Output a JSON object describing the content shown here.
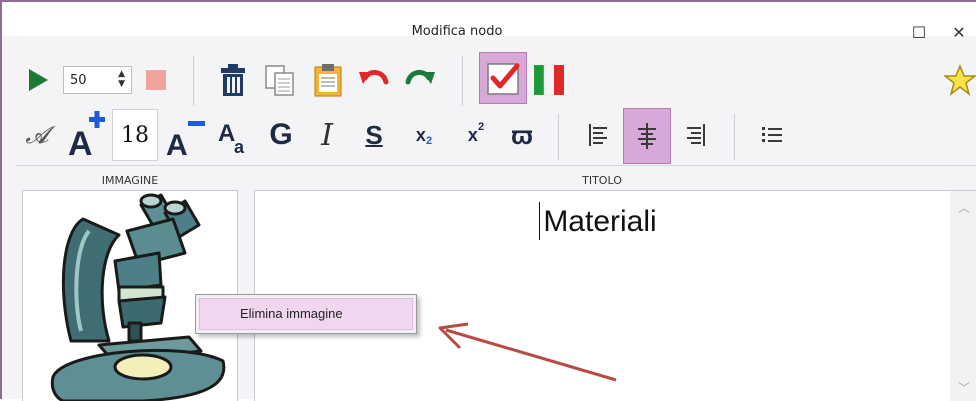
{
  "window": {
    "title": "Modifica nodo",
    "maximize_glyph": "☐",
    "close_glyph": "✕"
  },
  "toolbar1": {
    "play_icon": "play-icon",
    "speed_value": "50",
    "stop_icon": "stop-icon",
    "delete_icon": "trash-icon",
    "copy_icon": "copy-icon",
    "paste_icon": "paste-icon",
    "undo_icon": "undo-icon",
    "redo_icon": "redo-icon",
    "check_icon": "checkmark-icon",
    "flag_icon": "italian-flag-icon",
    "favorite_icon": "star-icon"
  },
  "toolbar2": {
    "font_style": "𝓐",
    "font_size": "18",
    "bold": "G",
    "italic": "I",
    "strike": "S",
    "subscript_base": "x",
    "subscript_index": "2",
    "superscript_base": "x",
    "superscript_index": "2",
    "symbol": "ϖ"
  },
  "panels": {
    "image_label": "IMMAGINE",
    "title_label": "TITOLO",
    "title_text": "Materiali"
  },
  "context_menu": {
    "items": [
      {
        "label": "Elimina immagine"
      }
    ]
  },
  "colors": {
    "window_border": "#8e6b99",
    "active_toggle": "#d8a8d8",
    "menu_highlight": "#f0d6ef",
    "arrow": "#b84a44"
  }
}
